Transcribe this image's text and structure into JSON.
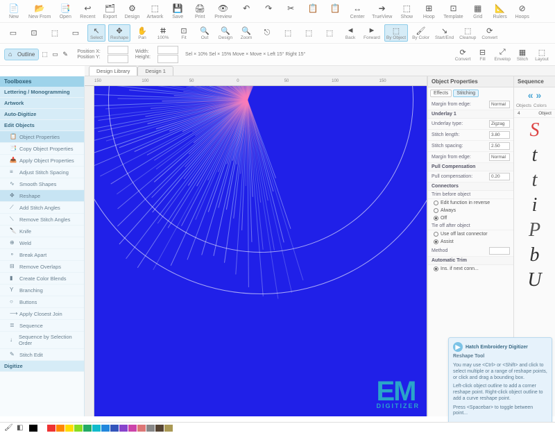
{
  "ribbon1": [
    {
      "icon": "📄",
      "label": "New"
    },
    {
      "icon": "📂",
      "label": "New From"
    },
    {
      "icon": "📑",
      "label": "Open"
    },
    {
      "icon": "↩",
      "label": "Recent"
    },
    {
      "icon": "🗂",
      "label": "Export"
    },
    {
      "icon": "⚙",
      "label": "Design"
    },
    {
      "icon": "⬚",
      "label": "Artwork"
    },
    {
      "icon": "💾",
      "label": "Save"
    },
    {
      "icon": "🖨",
      "label": "Print"
    },
    {
      "icon": "👁",
      "label": "Preview"
    },
    {
      "icon": "↶",
      "label": ""
    },
    {
      "icon": "↷",
      "label": ""
    },
    {
      "icon": "✂",
      "label": ""
    },
    {
      "icon": "📋",
      "label": ""
    },
    {
      "icon": "📋",
      "label": ""
    },
    {
      "icon": "↔",
      "label": "Center"
    },
    {
      "icon": "➔",
      "label": "TrueView"
    },
    {
      "icon": "⬚",
      "label": "Show"
    },
    {
      "icon": "⊞",
      "label": "Hoop"
    },
    {
      "icon": "⊡",
      "label": "Template"
    },
    {
      "icon": "▦",
      "label": "Grid"
    },
    {
      "icon": "📐",
      "label": "Rulers"
    },
    {
      "icon": "⊘",
      "label": "Hoops"
    }
  ],
  "ribbon2": [
    {
      "icon": "▭",
      "label": ""
    },
    {
      "icon": "⊡",
      "label": ""
    },
    {
      "icon": "⬚",
      "label": ""
    },
    {
      "icon": "▭",
      "label": ""
    },
    {
      "icon": "↖",
      "label": "Select",
      "sel": true
    },
    {
      "icon": "✥",
      "label": "Reshape",
      "sel": true
    },
    {
      "icon": "✋",
      "label": "Pan"
    },
    {
      "icon": "ⵌ",
      "label": "100%"
    },
    {
      "icon": "⊡",
      "label": "Fit"
    },
    {
      "icon": "🔍",
      "label": "Out"
    },
    {
      "icon": "🔍",
      "label": "Design"
    },
    {
      "icon": "🔍",
      "label": "Zoom"
    },
    {
      "icon": "⎋",
      "label": ""
    },
    {
      "icon": "⬚",
      "label": ""
    },
    {
      "icon": "⬚",
      "label": ""
    },
    {
      "icon": "⬚",
      "label": ""
    },
    {
      "icon": "◄",
      "label": "Back"
    },
    {
      "icon": "►",
      "label": "Forward"
    },
    {
      "icon": "⬚",
      "label": "By Object",
      "sel": true
    },
    {
      "icon": "🖌",
      "label": "By Color"
    },
    {
      "icon": "↘",
      "label": "Start/End"
    },
    {
      "icon": "⬚",
      "label": "Cleanup"
    },
    {
      "icon": "⟳",
      "label": "Convert"
    }
  ],
  "ribbon3": {
    "chip": "Outline",
    "position_label": "Position X:",
    "position_y_label": "Position Y:",
    "width_label": "Width:",
    "height_label": "Height:",
    "zoom_info": "Sel × 10%  Sel × 15%  Move ×  Move ×  Left 15°  Right 15°",
    "right_items": [
      {
        "icon": "⟳",
        "label": "Convert"
      },
      {
        "icon": "⊟",
        "label": "Fill"
      },
      {
        "icon": "⤢",
        "label": "Envelop"
      },
      {
        "icon": "▦",
        "label": "Stitch"
      },
      {
        "icon": "⬚",
        "label": "Layout"
      }
    ]
  },
  "tabs": [
    {
      "label": "Design Library",
      "active": false
    },
    {
      "label": "Design 1",
      "active": true
    }
  ],
  "ruler_marks": [
    "150",
    "100",
    "50",
    "0",
    "50",
    "100",
    "150"
  ],
  "toolbox": {
    "header": "Toolboxes",
    "items": [
      {
        "label": "Lettering / Monogramming",
        "type": "grp"
      },
      {
        "label": "Artwork",
        "type": "grp"
      },
      {
        "label": "Auto-Digitize",
        "type": "grp"
      },
      {
        "label": "Edit Objects",
        "type": "grp"
      },
      {
        "label": "Object Properties",
        "type": "sub",
        "sel": true,
        "icon": "📋"
      },
      {
        "label": "Copy Object Properties",
        "type": "sub",
        "icon": "📑"
      },
      {
        "label": "Apply Object Properties",
        "type": "sub",
        "icon": "📥"
      },
      {
        "label": "Adjust Stitch Spacing",
        "type": "sub",
        "icon": "≡"
      },
      {
        "label": "Smooth Shapes",
        "type": "sub",
        "icon": "∿"
      },
      {
        "label": "Reshape",
        "type": "sub",
        "sel": true,
        "icon": "✥"
      },
      {
        "label": "Add Stitch Angles",
        "type": "sub",
        "icon": "⟋"
      },
      {
        "label": "Remove Stitch Angles",
        "type": "sub",
        "icon": "⟍"
      },
      {
        "label": "Knife",
        "type": "sub",
        "icon": "🔪"
      },
      {
        "label": "Weld",
        "type": "sub",
        "icon": "⊕"
      },
      {
        "label": "Break Apart",
        "type": "sub",
        "icon": "⚬"
      },
      {
        "label": "Remove Overlaps",
        "type": "sub",
        "icon": "⊟"
      },
      {
        "label": "Create Color Blends",
        "type": "sub",
        "icon": "▮"
      },
      {
        "label": "Branching",
        "type": "sub",
        "icon": "Y"
      },
      {
        "label": "Buttons",
        "type": "sub",
        "icon": "○"
      },
      {
        "label": "Apply Closest Join",
        "type": "sub",
        "icon": "⟶"
      },
      {
        "label": "Sequence",
        "type": "sub",
        "icon": "≣"
      },
      {
        "label": "Sequence by Selection Order",
        "type": "sub",
        "icon": "↓"
      },
      {
        "label": "Stitch Edit",
        "type": "sub",
        "icon": "✎"
      },
      {
        "label": "Digitize",
        "type": "grp"
      }
    ]
  },
  "properties": {
    "header": "Object Properties",
    "tabs": [
      {
        "label": "Effects"
      },
      {
        "label": "Stitching",
        "active": true
      }
    ],
    "margin_label": "Margin from edge:",
    "margin_value": "Normal",
    "underlay_section": "Underlay 1",
    "underlay_type_label": "Underlay type:",
    "underlay_type_value": "Zigzag",
    "stitch_length_label": "Stitch length:",
    "stitch_length_value": "3.80",
    "stitch_spacing_label": "Stitch spacing:",
    "stitch_spacing_value": "2.50",
    "margin2_label": "Margin from edge:",
    "margin2_value": "Normal",
    "pull_section": "Pull Compensation",
    "pull_label": "Pull compensation:",
    "pull_value": "0.20",
    "connectors_section": "Connectors",
    "trim_before_label": "Trim before object",
    "conn_radio1": "Edit function in reverse",
    "conn_always": "Always",
    "conn_off": "Off",
    "tieoff_label": "Tie off after object",
    "conn_end_label": "Use off last connector",
    "assist_label": "Assist",
    "method_label": "Method",
    "auto_section": "Automatic Trim",
    "auto_check": "Ins. if next conn..."
  },
  "sequence": {
    "header": "Sequence",
    "nav": "« »",
    "tabs": [
      "Objects",
      "Colors"
    ],
    "num": "4",
    "obj": "Object",
    "glyphs": [
      "S",
      "t",
      "t",
      "i",
      "P",
      "b",
      "U"
    ]
  },
  "hint": {
    "title": "Hatch Embroidery Digitizer",
    "subtitle": "Reshape Tool",
    "p1": "You may use <Ctrl> or <Shift> and click to select multiple or a range of reshape points, or click and drag a bounding box.",
    "p2": "Left-click object outline to add a corner reshape point. Right-click object outline to add a curve reshape point.",
    "p3": "Press <Spacebar> to toggle between point..."
  },
  "watermark": {
    "em": "EM",
    "dg": "DIGITIZER"
  },
  "palette_colors": [
    "#000",
    "#fff",
    "#e33",
    "#f80",
    "#fd0",
    "#8d2",
    "#2a6",
    "#1bc",
    "#28d",
    "#35b",
    "#84c",
    "#c4a",
    "#d77",
    "#888",
    "#543",
    "#a95"
  ]
}
